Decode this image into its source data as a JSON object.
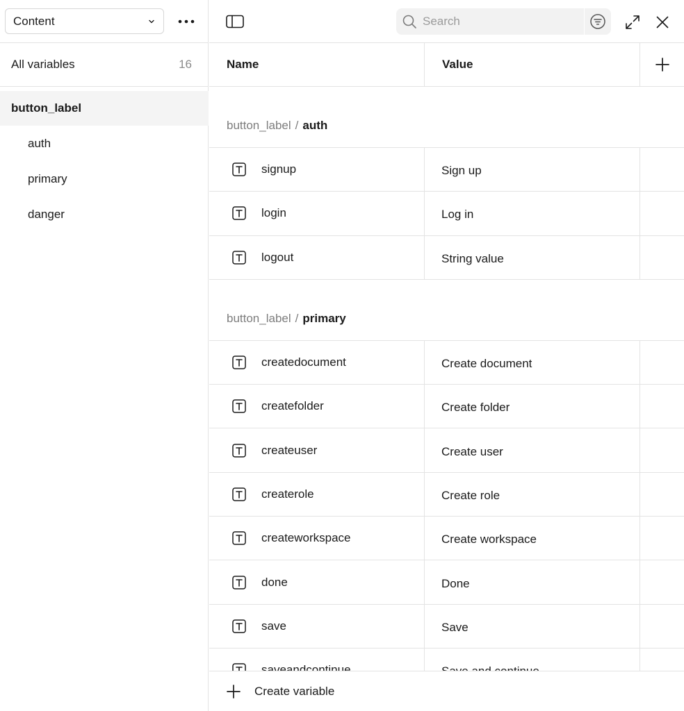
{
  "sidebar": {
    "collection_select": {
      "label": "Content"
    },
    "all_variables": {
      "label": "All variables",
      "count": "16"
    },
    "groups": [
      {
        "label": "button_label",
        "active": true
      },
      {
        "label": "auth"
      },
      {
        "label": "primary"
      },
      {
        "label": "danger"
      }
    ]
  },
  "toolbar": {
    "search_placeholder": "Search"
  },
  "table": {
    "columns": {
      "name": "Name",
      "value": "Value"
    },
    "groups": [
      {
        "path": "button_label",
        "separator": "/",
        "name": "auth",
        "rows": [
          {
            "name": "signup",
            "value": "Sign up"
          },
          {
            "name": "login",
            "value": "Log in"
          },
          {
            "name": "logout",
            "value": "String value"
          }
        ]
      },
      {
        "path": "button_label",
        "separator": "/",
        "name": "primary",
        "rows": [
          {
            "name": "createdocument",
            "value": "Create document"
          },
          {
            "name": "createfolder",
            "value": "Create folder"
          },
          {
            "name": "createuser",
            "value": "Create user"
          },
          {
            "name": "createrole",
            "value": "Create role"
          },
          {
            "name": "createworkspace",
            "value": "Create workspace"
          },
          {
            "name": "done",
            "value": "Done"
          },
          {
            "name": "save",
            "value": "Save"
          },
          {
            "name": "saveandcontinue",
            "value": "Save and continue"
          }
        ]
      }
    ]
  },
  "footer": {
    "create_label": "Create variable"
  },
  "icons": {
    "type": "text-type-icon",
    "chevron": "chevron-down-icon",
    "more": "more-horizontal-icon",
    "panel": "sidebar-panel-icon",
    "search": "search-icon",
    "filter": "filter-icon",
    "expand": "expand-icon",
    "close": "close-icon",
    "plus": "plus-icon"
  }
}
